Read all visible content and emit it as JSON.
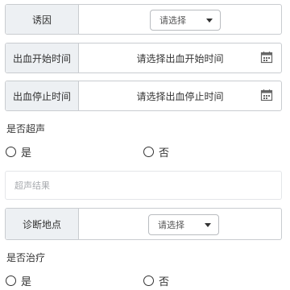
{
  "form": {
    "cause": {
      "label": "诱因",
      "select_value": "请选择"
    },
    "bleed_start": {
      "label": "出血开始时间",
      "value": "请选择出血开始时间"
    },
    "bleed_stop": {
      "label": "出血停止时间",
      "value": "请选择出血停止时间"
    },
    "ultrasound": {
      "title": "是否超声",
      "options": [
        "是",
        "否"
      ],
      "result_placeholder": "超声结果"
    },
    "diagnosis_location": {
      "label": "诊断地点",
      "select_value": "请选择"
    },
    "treatment": {
      "title": "是否治疗",
      "options": [
        "是",
        "否"
      ]
    }
  }
}
